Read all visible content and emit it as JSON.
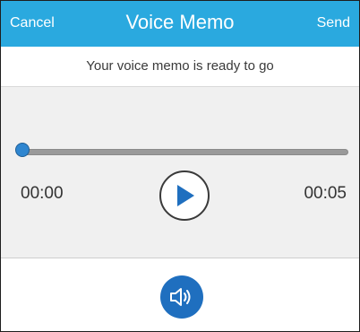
{
  "header": {
    "cancel_label": "Cancel",
    "title": "Voice Memo",
    "send_label": "Send",
    "background_color": "#2aa9df"
  },
  "status": {
    "message": "Your voice memo is ready to go"
  },
  "player": {
    "current_time": "00:00",
    "total_time": "00:05",
    "progress": 0,
    "accent_color": "#2f86d0",
    "play_icon": "play-icon"
  },
  "controls": {
    "speaker_icon": "speaker-icon",
    "speaker_color": "#1f6fbf"
  }
}
